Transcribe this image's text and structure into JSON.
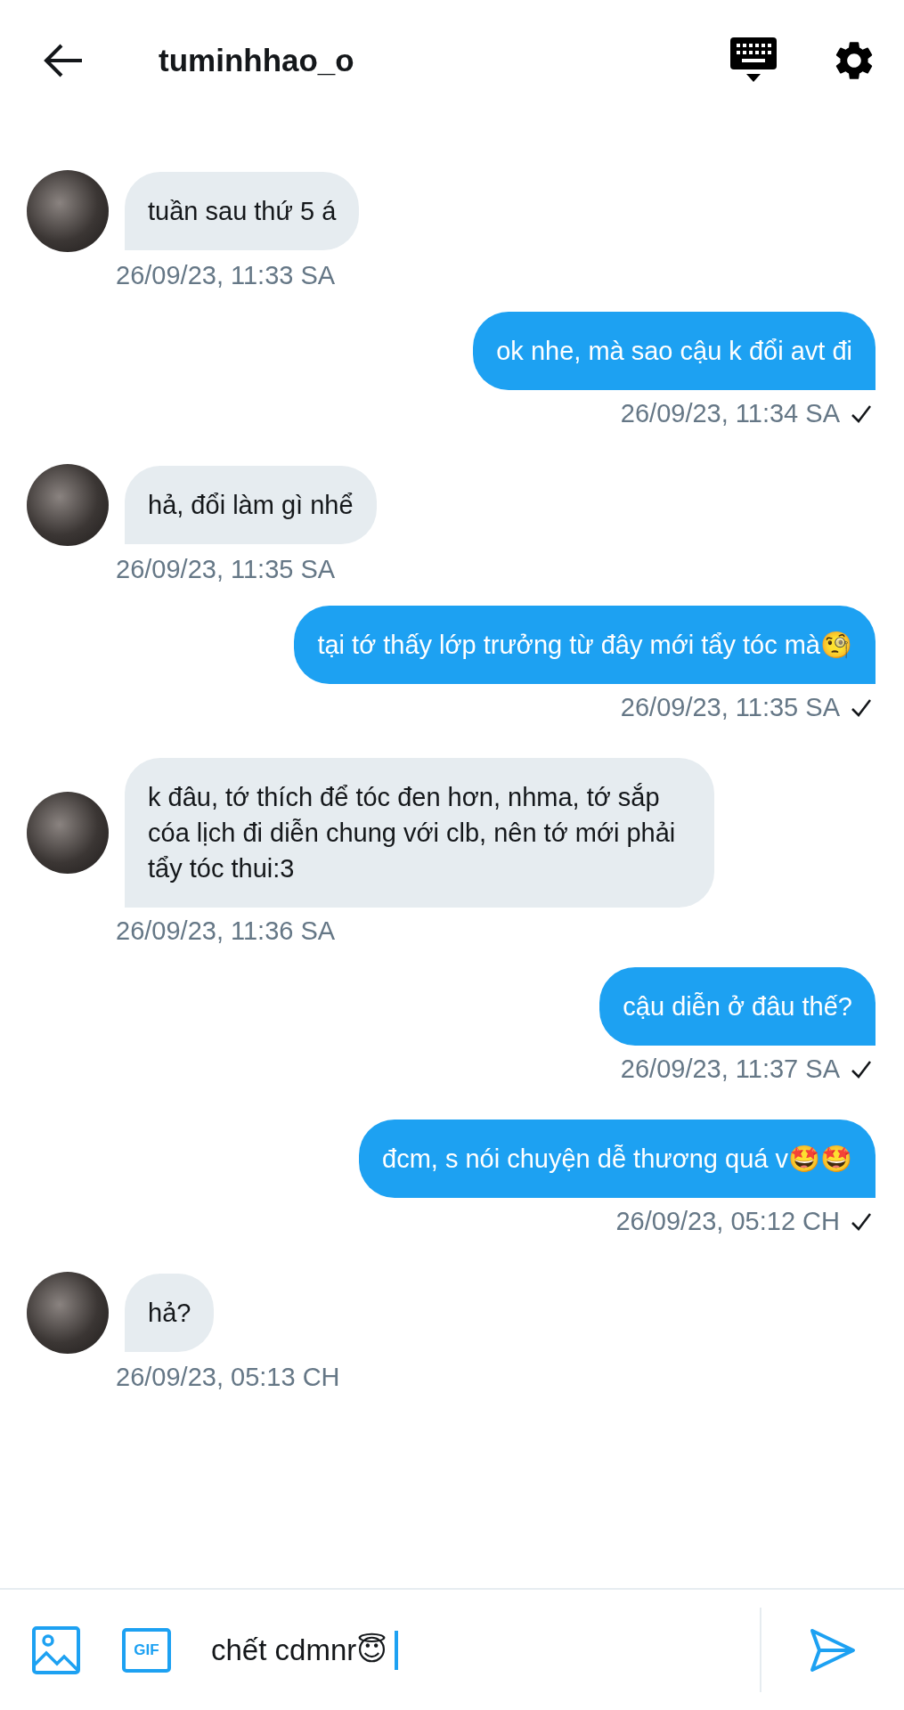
{
  "header": {
    "title": "tuminhhao_o"
  },
  "messages": [
    {
      "kind": "received",
      "text": "tuần sau thứ 5 á",
      "time": "26/09/23, 11:33 SA"
    },
    {
      "kind": "sent",
      "text": "ok nhe, mà sao cậu k đổi avt đi",
      "time": "26/09/23, 11:34 SA"
    },
    {
      "kind": "received",
      "text": "hả, đổi làm gì nhể",
      "time": "26/09/23, 11:35 SA"
    },
    {
      "kind": "sent",
      "text": "tại tớ thấy lớp trưởng từ đây mới tẩy tóc mà🧐",
      "time": "26/09/23, 11:35 SA"
    },
    {
      "kind": "received",
      "text": "k đâu, tớ thích để tóc đen hơn, nhma, tớ sắp cóa lịch đi diễn chung với clb, nên tớ mới phải tẩy tóc thui:3",
      "time": "26/09/23, 11:36 SA"
    },
    {
      "kind": "sent",
      "text": "cậu diễn ở đâu thế?",
      "time": "26/09/23, 11:37 SA"
    },
    {
      "kind": "sent",
      "text": "đcm, s nói chuyện dễ thương quá v🤩🤩",
      "time": "26/09/23, 05:12 CH"
    },
    {
      "kind": "received",
      "text": "hả?",
      "time": "26/09/23, 05:13 CH"
    }
  ],
  "composer": {
    "gif_label": "GIF",
    "value": "chết cdmnr😇"
  }
}
